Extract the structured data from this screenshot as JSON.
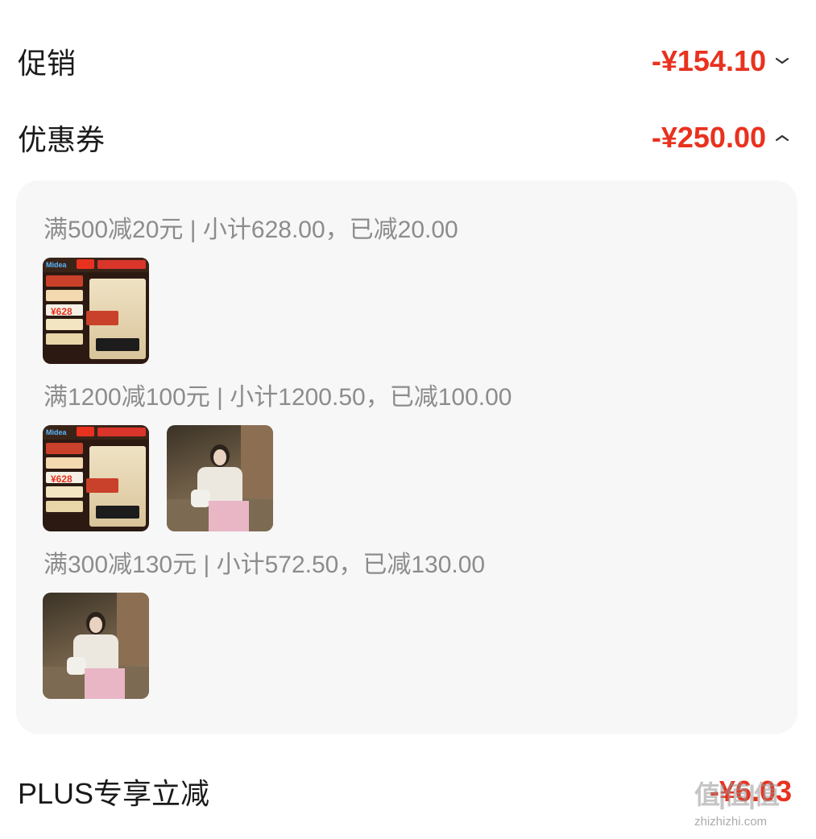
{
  "rows": {
    "promo": {
      "label": "促销",
      "amount": "-¥154.10",
      "chevron": "chevron-down-icon"
    },
    "coupon": {
      "label": "优惠券",
      "amount": "-¥250.00",
      "chevron": "chevron-up-icon"
    },
    "plus": {
      "label": "PLUS专享立减",
      "amount": "-¥6.03"
    }
  },
  "coupon_groups": [
    {
      "title": "满500减20元 | 小计628.00，已减20.00",
      "products": [
        "water-heater"
      ]
    },
    {
      "title": "满1200减100元 | 小计1200.50，已减100.00",
      "products": [
        "water-heater",
        "fashion-photo"
      ]
    },
    {
      "title": "满300减130元 | 小计572.50，已减130.00",
      "products": [
        "fashion-photo"
      ]
    }
  ],
  "heater_thumb": {
    "brand": "Midea",
    "price": "¥628"
  },
  "watermark": {
    "logo": "值|值|值",
    "url": "zhizhizhi.com"
  },
  "colors": {
    "accent": "#e8321f",
    "muted": "#8c8c8c",
    "panel": "#f7f7f7"
  }
}
